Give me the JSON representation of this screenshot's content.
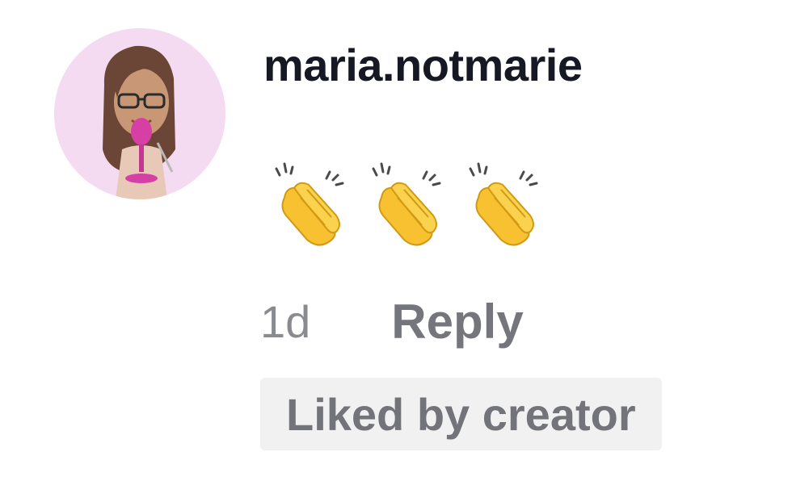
{
  "comment": {
    "author": {
      "username": "maria.notmarie",
      "avatar_icon": "memoji-woman-microphone-avatar"
    },
    "body": {
      "emojis": [
        "👏",
        "👏",
        "👏"
      ],
      "emoji_icon": "clapping-hands-icon"
    },
    "timestamp": "1d",
    "reply_label": "Reply",
    "badge": "Liked by creator"
  },
  "colors": {
    "username": "#161823",
    "meta": "#8a8b91",
    "reply": "#75767c",
    "badge_bg": "#f1f1f2",
    "badge_text": "#73747a",
    "avatar_bg": "#f4dbf2"
  }
}
